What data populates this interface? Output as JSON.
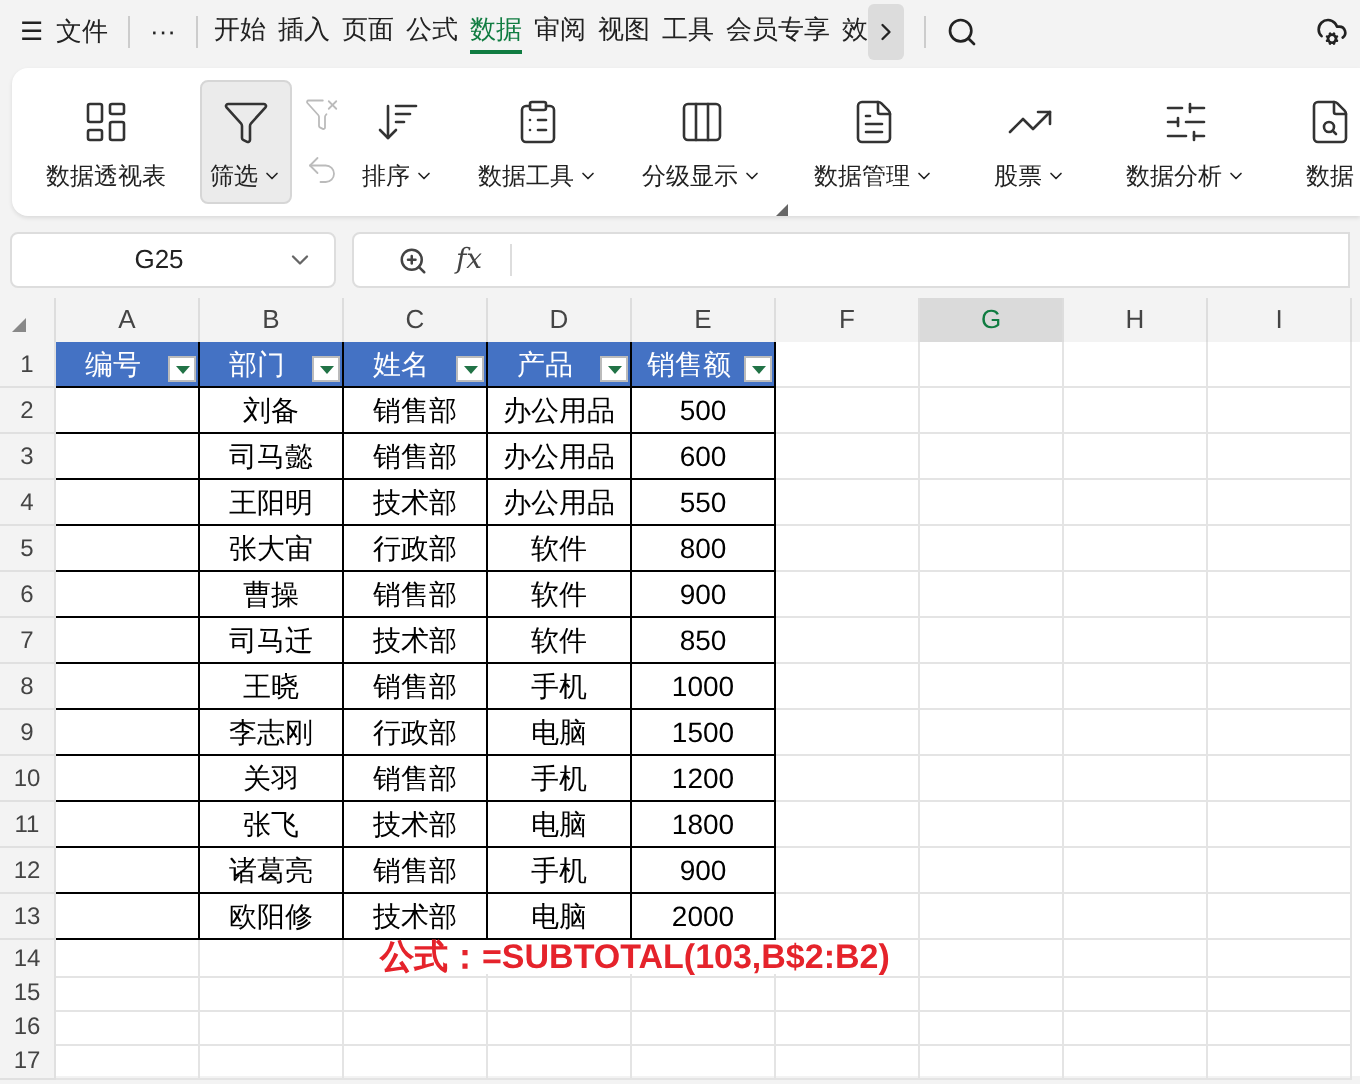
{
  "menu": {
    "hamburger": "☰",
    "file": "文件",
    "more": "···",
    "tabs": [
      {
        "label": "开始",
        "selected": false
      },
      {
        "label": "插入",
        "selected": false
      },
      {
        "label": "页面",
        "selected": false
      },
      {
        "label": "公式",
        "selected": false
      },
      {
        "label": "数据",
        "selected": true
      },
      {
        "label": "审阅",
        "selected": false
      },
      {
        "label": "视图",
        "selected": false
      },
      {
        "label": "工具",
        "selected": false
      },
      {
        "label": "会员专享",
        "selected": false
      },
      {
        "label": "效",
        "selected": false
      }
    ]
  },
  "ribbon": [
    {
      "label": "数据透视表",
      "caret": false,
      "selected": false
    },
    {
      "label": "筛选",
      "caret": true,
      "selected": true
    },
    {
      "label": "排序",
      "caret": true,
      "selected": false
    },
    {
      "label": "数据工具",
      "caret": true,
      "selected": false
    },
    {
      "label": "分级显示",
      "caret": true,
      "selected": false
    },
    {
      "label": "数据管理",
      "caret": true,
      "selected": false
    },
    {
      "label": "股票",
      "caret": true,
      "selected": false
    },
    {
      "label": "数据分析",
      "caret": true,
      "selected": false
    },
    {
      "label": "数据",
      "caret": false,
      "selected": false
    }
  ],
  "name_box": "G25",
  "function_label": "fx",
  "columns": [
    {
      "label": "A",
      "selected": false
    },
    {
      "label": "B",
      "selected": false
    },
    {
      "label": "C",
      "selected": false
    },
    {
      "label": "D",
      "selected": false
    },
    {
      "label": "E",
      "selected": false
    },
    {
      "label": "F",
      "selected": false
    },
    {
      "label": "G",
      "selected": true
    },
    {
      "label": "H",
      "selected": false
    },
    {
      "label": "I",
      "selected": false
    }
  ],
  "headers": [
    "编号",
    "部门",
    "姓名",
    "产品",
    "销售额"
  ],
  "rows": [
    [
      "刘备",
      "销售部",
      "办公用品",
      "500"
    ],
    [
      "司马懿",
      "销售部",
      "办公用品",
      "600"
    ],
    [
      "王阳明",
      "技术部",
      "办公用品",
      "550"
    ],
    [
      "张大宙",
      "行政部",
      "软件",
      "800"
    ],
    [
      "曹操",
      "销售部",
      "软件",
      "900"
    ],
    [
      "司马迁",
      "技术部",
      "软件",
      "850"
    ],
    [
      "王晓",
      "销售部",
      "手机",
      "1000"
    ],
    [
      "李志刚",
      "行政部",
      "电脑",
      "1500"
    ],
    [
      "关羽",
      "销售部",
      "手机",
      "1200"
    ],
    [
      "张飞",
      "技术部",
      "电脑",
      "1800"
    ],
    [
      "诸葛亮",
      "销售部",
      "手机",
      "900"
    ],
    [
      "欧阳修",
      "技术部",
      "电脑",
      "2000"
    ]
  ],
  "row_numbers": [
    "1",
    "2",
    "3",
    "4",
    "5",
    "6",
    "7",
    "8",
    "9",
    "10",
    "11",
    "12",
    "13",
    "14",
    "15",
    "16",
    "17"
  ],
  "annotation": "公式：=SUBTOTAL(103,B$2:B2)"
}
